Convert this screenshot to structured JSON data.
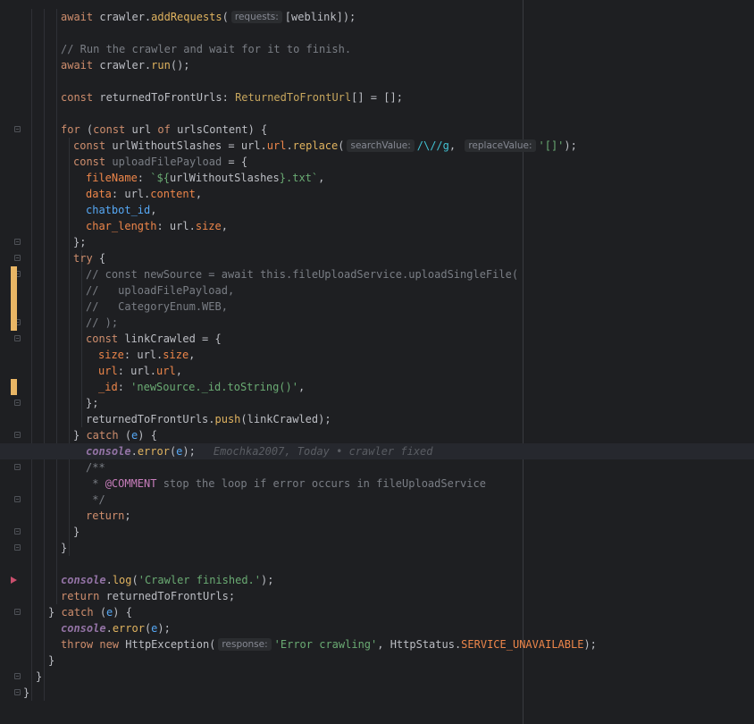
{
  "editor": {
    "lines": [
      {
        "tokens": [
          {
            "t": "await ",
            "c": "kw"
          },
          {
            "t": "crawler.",
            "c": "pl"
          },
          {
            "t": "addRequests",
            "c": "mt"
          },
          {
            "t": "(",
            "c": "pl"
          },
          {
            "hint": "requests:"
          },
          {
            "t": "[weblink]);",
            "c": "pl"
          }
        ]
      },
      {
        "tokens": []
      },
      {
        "tokens": [
          {
            "t": "// Run the crawler and wait for it to finish.",
            "c": "cm"
          }
        ]
      },
      {
        "tokens": [
          {
            "t": "await ",
            "c": "kw"
          },
          {
            "t": "crawler.",
            "c": "pl"
          },
          {
            "t": "run",
            "c": "mt"
          },
          {
            "t": "();",
            "c": "pl"
          }
        ]
      },
      {
        "tokens": []
      },
      {
        "tokens": [
          {
            "t": "const ",
            "c": "kw"
          },
          {
            "t": "returnedToFrontUrls: ",
            "c": "pl"
          },
          {
            "t": "ReturnedToFrontUrl",
            "c": "ty"
          },
          {
            "t": "[] = [];",
            "c": "pl"
          }
        ]
      },
      {
        "tokens": []
      },
      {
        "tokens": [
          {
            "t": "for ",
            "c": "kw"
          },
          {
            "t": "(",
            "c": "pl"
          },
          {
            "t": "const ",
            "c": "kw"
          },
          {
            "t": "url ",
            "c": "pl"
          },
          {
            "t": "of ",
            "c": "kw"
          },
          {
            "t": "urlsContent) {",
            "c": "pl"
          }
        ]
      },
      {
        "tokens": [
          {
            "t": "const ",
            "c": "kw"
          },
          {
            "t": "urlWithoutSlashes = url.",
            "c": "pl"
          },
          {
            "t": "url",
            "c": "prop"
          },
          {
            "t": ".",
            "c": "pl"
          },
          {
            "t": "replace",
            "c": "mt"
          },
          {
            "t": "(",
            "c": "pl"
          },
          {
            "hint": "searchValue:"
          },
          {
            "t": "/\\//g",
            "c": "rx"
          },
          {
            "t": ", ",
            "c": "pl"
          },
          {
            "hint": "replaceValue:"
          },
          {
            "t": "'[]'",
            "c": "str"
          },
          {
            "t": ");",
            "c": "pl"
          }
        ]
      },
      {
        "tokens": [
          {
            "t": "const ",
            "c": "kw"
          },
          {
            "t": "uploadFilePayload",
            "c": "cm"
          },
          {
            "t": " = {",
            "c": "pl"
          }
        ]
      },
      {
        "tokens": [
          {
            "t": "fileName",
            "c": "prop"
          },
          {
            "t": ": ",
            "c": "pl"
          },
          {
            "t": "`${",
            "c": "str"
          },
          {
            "t": "urlWithoutSlashes",
            "c": "pl"
          },
          {
            "t": "}.txt`",
            "c": "str"
          },
          {
            "t": ",",
            "c": "pl"
          }
        ]
      },
      {
        "tokens": [
          {
            "t": "data",
            "c": "prop"
          },
          {
            "t": ": url.",
            "c": "pl"
          },
          {
            "t": "content",
            "c": "prop"
          },
          {
            "t": ",",
            "c": "pl"
          }
        ]
      },
      {
        "tokens": [
          {
            "t": "chatbot_id",
            "c": "fn"
          },
          {
            "t": ",",
            "c": "pl"
          }
        ]
      },
      {
        "tokens": [
          {
            "t": "char_length",
            "c": "prop"
          },
          {
            "t": ": url.",
            "c": "pl"
          },
          {
            "t": "size",
            "c": "prop"
          },
          {
            "t": ",",
            "c": "pl"
          }
        ]
      },
      {
        "tokens": [
          {
            "t": "};",
            "c": "pl"
          }
        ]
      },
      {
        "tokens": [
          {
            "t": "try ",
            "c": "kw"
          },
          {
            "t": "{",
            "c": "pl"
          }
        ]
      },
      {
        "tokens": [
          {
            "t": "// const newSource = await this.fileUploadService.uploadSingleFile(",
            "c": "cm"
          }
        ]
      },
      {
        "tokens": [
          {
            "t": "//   uploadFilePayload,",
            "c": "cm"
          }
        ]
      },
      {
        "tokens": [
          {
            "t": "//   CategoryEnum.WEB,",
            "c": "cm"
          }
        ]
      },
      {
        "tokens": [
          {
            "t": "// );",
            "c": "cm"
          }
        ]
      },
      {
        "tokens": [
          {
            "t": "const ",
            "c": "kw"
          },
          {
            "t": "linkCrawled = {",
            "c": "pl"
          }
        ]
      },
      {
        "tokens": [
          {
            "t": "size",
            "c": "prop"
          },
          {
            "t": ": url.",
            "c": "pl"
          },
          {
            "t": "size",
            "c": "prop"
          },
          {
            "t": ",",
            "c": "pl"
          }
        ]
      },
      {
        "tokens": [
          {
            "t": "url",
            "c": "prop"
          },
          {
            "t": ": url.",
            "c": "pl"
          },
          {
            "t": "url",
            "c": "prop"
          },
          {
            "t": ",",
            "c": "pl"
          }
        ]
      },
      {
        "tokens": [
          {
            "t": "_id",
            "c": "prop"
          },
          {
            "t": ": ",
            "c": "pl"
          },
          {
            "t": "'newSource._id.toString()'",
            "c": "str"
          },
          {
            "t": ",",
            "c": "pl"
          }
        ]
      },
      {
        "tokens": [
          {
            "t": "};",
            "c": "pl"
          }
        ]
      },
      {
        "tokens": [
          {
            "t": "returnedToFrontUrls.",
            "c": "pl"
          },
          {
            "t": "push",
            "c": "mt"
          },
          {
            "t": "(linkCrawled);",
            "c": "pl"
          }
        ]
      },
      {
        "tokens": [
          {
            "t": "} ",
            "c": "pl"
          },
          {
            "t": "catch ",
            "c": "kw"
          },
          {
            "t": "(",
            "c": "pl"
          },
          {
            "t": "e",
            "c": "fn"
          },
          {
            "t": ") {",
            "c": "pl"
          }
        ]
      },
      {
        "tokens": [
          {
            "t": "console",
            "c": "cons"
          },
          {
            "t": ".",
            "c": "pl"
          },
          {
            "t": "error",
            "c": "mt"
          },
          {
            "t": "(",
            "c": "pl"
          },
          {
            "t": "e",
            "c": "fn"
          },
          {
            "t": ");",
            "c": "pl"
          }
        ],
        "blame": "Emochka2007, Today • crawler fixed"
      },
      {
        "tokens": [
          {
            "t": "/**",
            "c": "cm"
          }
        ]
      },
      {
        "tokens": [
          {
            "t": " * ",
            "c": "cm"
          },
          {
            "t": "@COMMENT",
            "c": "purple"
          },
          {
            "t": " stop the loop if error occurs in fileUploadService",
            "c": "cm"
          }
        ]
      },
      {
        "tokens": [
          {
            "t": " */",
            "c": "cm"
          }
        ]
      },
      {
        "tokens": [
          {
            "t": "return",
            "c": "kw"
          },
          {
            "t": ";",
            "c": "pl"
          }
        ]
      },
      {
        "tokens": [
          {
            "t": "}",
            "c": "pl"
          }
        ]
      },
      {
        "tokens": [
          {
            "t": "}",
            "c": "pl"
          }
        ]
      },
      {
        "tokens": []
      },
      {
        "tokens": [
          {
            "t": "console",
            "c": "cons"
          },
          {
            "t": ".",
            "c": "pl"
          },
          {
            "t": "log",
            "c": "mt"
          },
          {
            "t": "(",
            "c": "pl"
          },
          {
            "t": "'Crawler finished.'",
            "c": "str"
          },
          {
            "t": ");",
            "c": "pl"
          }
        ]
      },
      {
        "tokens": [
          {
            "t": "return ",
            "c": "kw"
          },
          {
            "t": "returnedToFrontUrls;",
            "c": "pl"
          }
        ]
      },
      {
        "tokens": [
          {
            "t": "} ",
            "c": "pl"
          },
          {
            "t": "catch ",
            "c": "kw"
          },
          {
            "t": "(",
            "c": "pl"
          },
          {
            "t": "e",
            "c": "fn"
          },
          {
            "t": ") {",
            "c": "pl"
          }
        ]
      },
      {
        "tokens": [
          {
            "t": "console",
            "c": "cons"
          },
          {
            "t": ".",
            "c": "pl"
          },
          {
            "t": "error",
            "c": "mt"
          },
          {
            "t": "(",
            "c": "pl"
          },
          {
            "t": "e",
            "c": "fn"
          },
          {
            "t": ");",
            "c": "pl"
          }
        ]
      },
      {
        "tokens": [
          {
            "t": "throw ",
            "c": "kw"
          },
          {
            "t": "new ",
            "c": "kw"
          },
          {
            "t": "HttpException(",
            "c": "pl"
          },
          {
            "hint": "response:"
          },
          {
            "t": "'Error crawling'",
            "c": "str"
          },
          {
            "t": ", HttpStatus.",
            "c": "pl"
          },
          {
            "t": "SERVICE_UNAVAILABLE",
            "c": "prop"
          },
          {
            "t": ");",
            "c": "pl"
          }
        ]
      },
      {
        "tokens": [
          {
            "t": "}",
            "c": "pl"
          }
        ]
      },
      {
        "tokens": [
          {
            "t": "}",
            "c": "pl"
          }
        ]
      },
      {
        "tokens": [
          {
            "t": "}",
            "c": "pl"
          }
        ]
      }
    ],
    "colors": {
      "background": "#1e1f22",
      "change_marker": "#e9b665",
      "breakpoint_arrow": "#c94f6d"
    }
  }
}
